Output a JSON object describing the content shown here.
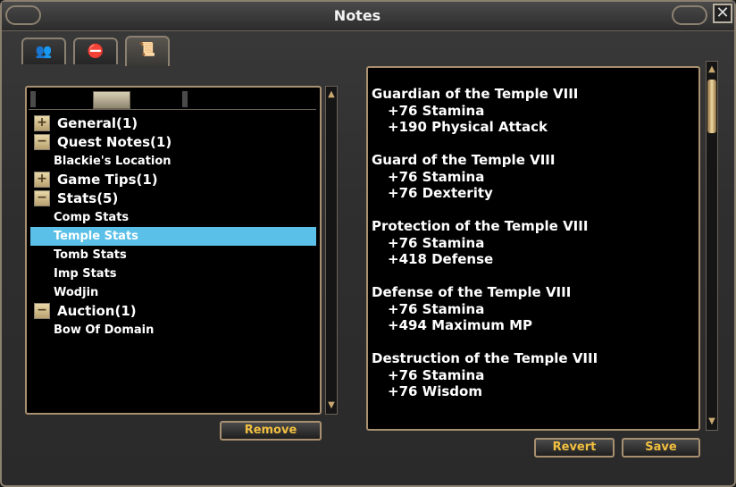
{
  "window": {
    "title": "Notes",
    "close_glyph": "✕"
  },
  "tabs": [
    {
      "name": "friends-tab-icon",
      "glyph": "👥",
      "color": "#3ab0c8"
    },
    {
      "name": "blocked-tab-icon",
      "glyph": "⛔",
      "color": "#c02030"
    },
    {
      "name": "notes-tab-icon",
      "glyph": "📜",
      "color": "#d8cfb5"
    }
  ],
  "tree": {
    "categories": [
      {
        "label": "General(1)",
        "expander": "+",
        "children": []
      },
      {
        "label": "Quest Notes(1)",
        "expander": "−",
        "children": [
          "Blackie's Location"
        ]
      },
      {
        "label": "Game Tips(1)",
        "expander": "+",
        "children": []
      },
      {
        "label": "Stats(5)",
        "expander": "−",
        "children": [
          "Comp Stats",
          "Temple Stats",
          "Tomb Stats",
          "Imp Stats",
          "Wodjin"
        ]
      },
      {
        "label": "Auction(1)",
        "expander": "−",
        "children": [
          "Bow Of Domain"
        ]
      }
    ],
    "selected": "Temple Stats"
  },
  "buttons": {
    "remove": "Remove",
    "revert": "Revert",
    "save": "Save"
  },
  "note": {
    "blocks": [
      {
        "title": "Guardian of the Temple VIII",
        "lines": [
          "+76 Stamina",
          "+190 Physical Attack"
        ]
      },
      {
        "title": "Guard of the Temple VIII",
        "lines": [
          "+76 Stamina",
          "+76 Dexterity"
        ]
      },
      {
        "title": "Protection of the Temple VIII",
        "lines": [
          "+76 Stamina",
          "+418 Defense"
        ]
      },
      {
        "title": "Defense of the Temple VIII",
        "lines": [
          "+76 Stamina",
          "+494 Maximum MP"
        ]
      },
      {
        "title": "Destruction of the Temple VIII",
        "lines": [
          "+76 Stamina",
          "+76 Wisdom"
        ]
      }
    ]
  },
  "colors": {
    "accent_text": "#f2c040",
    "selection": "#5ac0e8",
    "frame": "#a89070"
  }
}
